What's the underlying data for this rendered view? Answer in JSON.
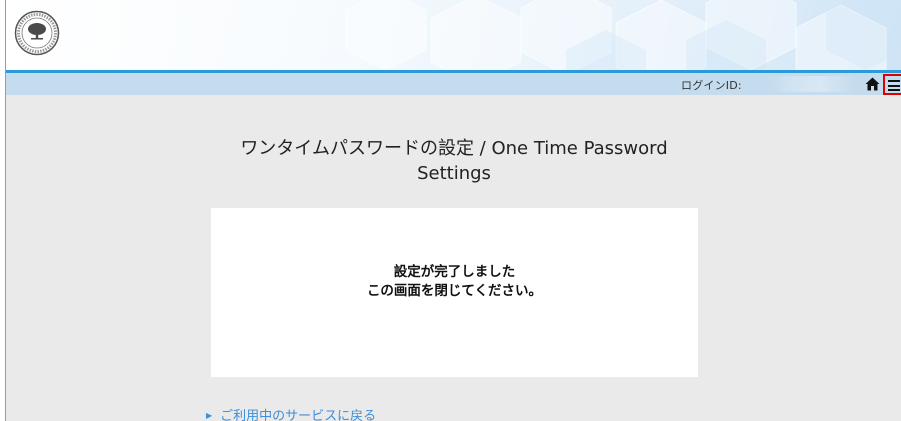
{
  "header": {
    "logo_name": "university-seal-logo",
    "login_label": "ログインID:",
    "login_value": ""
  },
  "main": {
    "title_line1": "ワンタイムパスワードの設定 / One Time Password",
    "title_line2": "Settings",
    "message_line1": "設定が完了しました",
    "message_line2": "この画面を閉じてください。",
    "back_link": "ご利用中のサービスに戻る"
  },
  "icons": {
    "home": "home-icon",
    "menu": "hamburger-menu-icon",
    "link_arrow": "triangle-right-icon"
  },
  "colors": {
    "accent_line": "#2c9ad8",
    "bar": "#c4dcee",
    "highlight_border": "#e00000",
    "link": "#3f8ed6"
  }
}
